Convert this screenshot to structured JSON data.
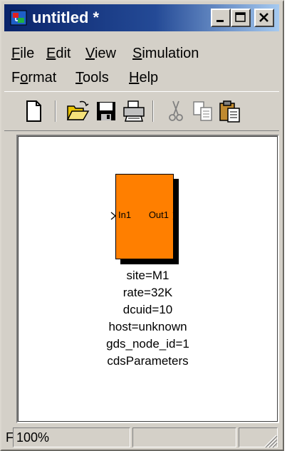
{
  "window": {
    "title": "untitled *",
    "icon": "simulink-model-icon",
    "controls": [
      "minimize-icon",
      "maximize-icon",
      "close-icon"
    ]
  },
  "menubar": {
    "row1": [
      {
        "label": "File",
        "accel": "F",
        "rest": "ile"
      },
      {
        "label": "Edit",
        "accel": "E",
        "rest": "dit"
      },
      {
        "label": "View",
        "accel": "V",
        "rest": "iew"
      },
      {
        "label": "Simulation",
        "accel": "S",
        "rest": "imulation"
      }
    ],
    "row2": [
      {
        "label": "Format",
        "pre": "F",
        "accel": "o",
        "rest": "rmat"
      },
      {
        "label": "Tools",
        "accel": "T",
        "rest": "ools"
      },
      {
        "label": "Help",
        "accel": "H",
        "rest": "elp"
      }
    ]
  },
  "toolbar": {
    "buttons": [
      "new-icon",
      "open-icon",
      "save-icon",
      "print-icon",
      "cut-icon",
      "copy-icon",
      "paste-icon"
    ]
  },
  "block": {
    "in_label": "In1",
    "out_label": "Out1",
    "color": "#ff7f00",
    "params": [
      "site=M1",
      "rate=32K",
      "dcuid=10",
      "host=unknown",
      "gds_node_id=1",
      "cdsParameters"
    ]
  },
  "status": {
    "left": "F",
    "zoom": "100%",
    "pane3": "",
    "pane4": ""
  }
}
